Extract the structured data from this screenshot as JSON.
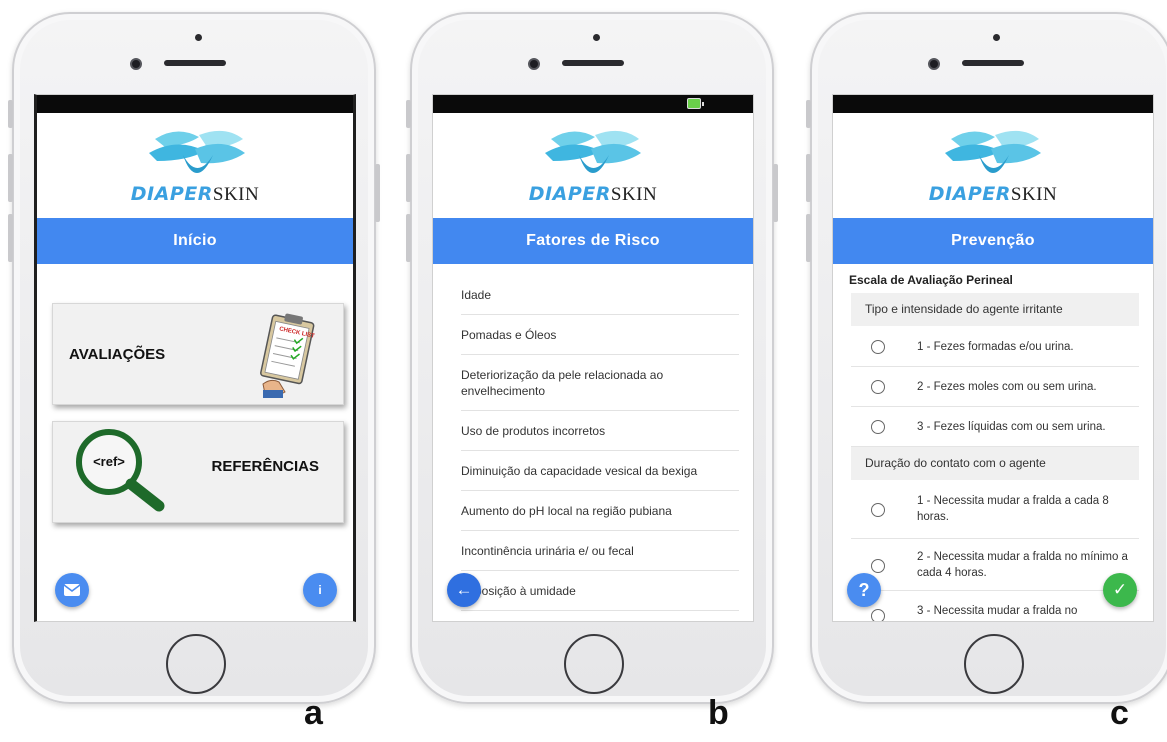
{
  "app": {
    "logo_part1": "DIAPER",
    "logo_part2": "SKIN"
  },
  "screen_a": {
    "title": "Início",
    "cards": {
      "avaliacoes": "AVALIAÇÕES",
      "referencias": "REFERÊNCIAS"
    },
    "clipboard_header": "CHECK LIST",
    "ref_icon_text": "<ref>",
    "info_label": "i"
  },
  "screen_b": {
    "title": "Fatores de Risco",
    "items": [
      "Idade",
      "Pomadas e Óleos",
      "Deteriorização da pele relacionada ao envelhecimento",
      "Uso de produtos incorretos",
      "Diminuição da capacidade vesical da bexiga",
      "Aumento do pH local na região pubiana",
      "Incontinência urinária e/ ou fecal",
      "Exposição à umidade"
    ],
    "back_label": "←"
  },
  "screen_c": {
    "title": "Prevenção",
    "scale_title": "Escala de Avaliação Perineal",
    "category_1": "Tipo e intensidade do agente irritante",
    "category_1_options": [
      "1 - Fezes formadas e/ou urina.",
      "2 - Fezes moles com ou sem urina.",
      "3 - Fezes líquidas com ou sem urina."
    ],
    "category_2": "Duração do contato com o agente",
    "category_2_options": [
      "1 - Necessita mudar a fralda a cada 8 horas.",
      "2 - Necessita mudar a fralda no mínimo a cada 4 horas.",
      "3 - Necessita mudar a fralda no"
    ],
    "help_label": "?",
    "confirm_label": "✓"
  },
  "panel_labels": {
    "a": "a",
    "b": "b",
    "c": "c"
  },
  "colors": {
    "header_blue": "#4288f0",
    "fab_blue": "#4a8cf0",
    "fab_green": "#3cb84c",
    "status_bar": "#0a0a0a"
  }
}
